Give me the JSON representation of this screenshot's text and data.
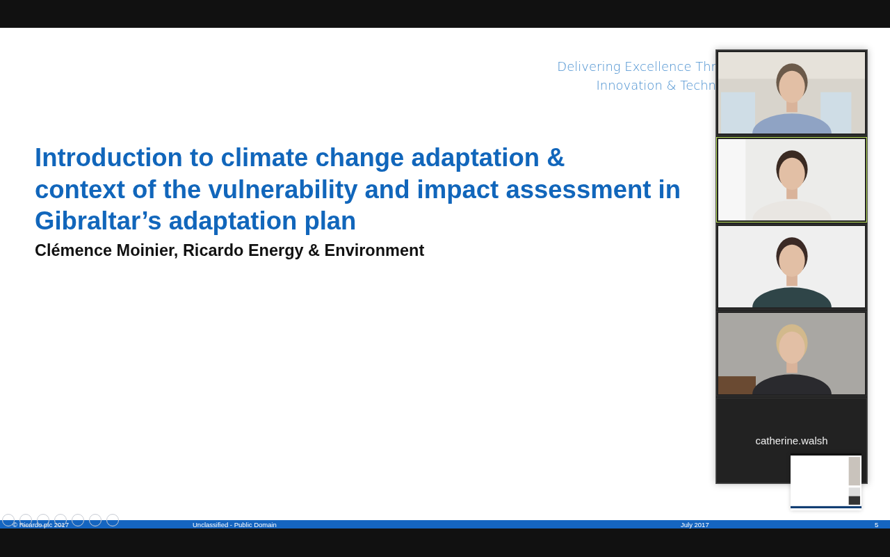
{
  "slide": {
    "tagline": [
      "Delivering Excellence Thr",
      "Innovation & Techn"
    ],
    "title_lines": [
      "Introduction to climate change adaptation &",
      "context of the vulnerability and impact assessment in",
      "Gibraltar’s adaptation plan"
    ],
    "author": "Clémence Moinier, Ricardo Energy & Environment",
    "footer": {
      "copyright": "© Ricardo plc 2017",
      "classification": "Unclassified - Public Domain",
      "date": "July 2017",
      "page": "5"
    }
  },
  "participants": [
    {
      "kind": "video",
      "active_speaker": false
    },
    {
      "kind": "video",
      "active_speaker": true
    },
    {
      "kind": "video",
      "active_speaker": false
    },
    {
      "kind": "video",
      "active_speaker": false
    },
    {
      "kind": "name",
      "name": "catherine.walsh",
      "active_speaker": false
    }
  ]
}
